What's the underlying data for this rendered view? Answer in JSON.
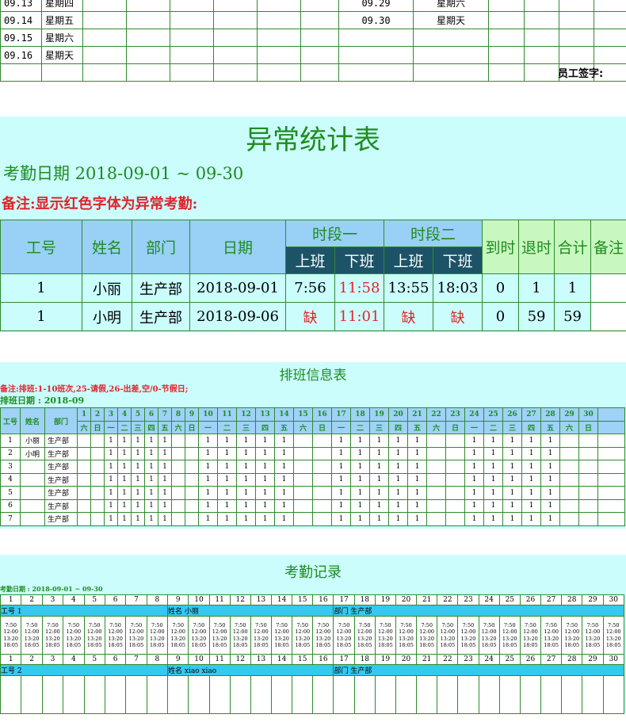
{
  "top_sheet": {
    "left_rows": [
      [
        "09.13",
        "星期四"
      ],
      [
        "09.14",
        "星期五"
      ],
      [
        "09.15",
        "星期六"
      ],
      [
        "09.16",
        "星期天"
      ]
    ],
    "right_rows": [
      [
        "09.29",
        "星期六"
      ],
      [
        "09.30",
        "星期天"
      ]
    ],
    "signature_label": "员工签字:"
  },
  "abnormal": {
    "title": "异常统计表",
    "date_line": "考勤日期 2018-09-01 ~ 09-30",
    "note": "备注:显示红色字体为异常考勤:",
    "headers": {
      "id": "工号",
      "name": "姓名",
      "dept": "部门",
      "date": "日期",
      "seg1": "时段一",
      "seg2": "时段二",
      "on": "上班",
      "off": "下班",
      "late": "到时",
      "early": "退时",
      "total": "合计",
      "remark": "备注"
    },
    "rows": [
      {
        "id": "1",
        "name": "小丽",
        "dept": "生产部",
        "date": "2018-09-01",
        "in1": "7:56",
        "out1": "11:58",
        "in2": "13:55",
        "out2": "18:03",
        "late": "0",
        "early": "1",
        "total": "1",
        "remark": ""
      },
      {
        "id": "1",
        "name": "小明",
        "dept": "生产部",
        "date": "2018-09-06",
        "in1": "缺",
        "out1": "11:01",
        "in2": "缺",
        "out2": "缺",
        "late": "0",
        "early": "59",
        "total": "59",
        "remark": ""
      }
    ]
  },
  "schedule": {
    "title": "排班信息表",
    "note": "备注:排班:1-10班次,25-请假,26-出差,空/0-节假日;",
    "period": "排班日期 : 2018-09",
    "headers": {
      "id": "工号",
      "name": "姓名",
      "dept": "部门"
    },
    "days": [
      "1",
      "2",
      "3",
      "4",
      "5",
      "6",
      "7",
      "8",
      "9",
      "10",
      "11",
      "12",
      "13",
      "14",
      "15",
      "16",
      "17",
      "18",
      "19",
      "20",
      "21",
      "22",
      "23",
      "24",
      "25",
      "26",
      "27",
      "28",
      "29",
      "30"
    ],
    "weekdays": [
      "六",
      "日",
      "一",
      "二",
      "三",
      "四",
      "五",
      "六",
      "日",
      "一",
      "二",
      "三",
      "四",
      "五",
      "六",
      "日",
      "一",
      "二",
      "三",
      "四",
      "五",
      "六",
      "日",
      "一",
      "二",
      "三",
      "四",
      "五",
      "六",
      "日"
    ],
    "rows": [
      {
        "id": "1",
        "name": "小丽",
        "dept": "生产部"
      },
      {
        "id": "2",
        "name": "小明",
        "dept": "生产部"
      },
      {
        "id": "3",
        "name": "",
        "dept": "生产部"
      },
      {
        "id": "4",
        "name": "",
        "dept": "生产部"
      },
      {
        "id": "5",
        "name": "",
        "dept": "生产部"
      },
      {
        "id": "6",
        "name": "",
        "dept": "生产部"
      },
      {
        "id": "7",
        "name": "",
        "dept": "生产部"
      }
    ],
    "shift_value": "1"
  },
  "records": {
    "title": "考勤记录",
    "date_line": "考勤日期 :   2018-09-01 ~ 09-30",
    "days": [
      "1",
      "2",
      "3",
      "4",
      "5",
      "6",
      "7",
      "8",
      "9",
      "10",
      "11",
      "12",
      "13",
      "14",
      "15",
      "16",
      "17",
      "18",
      "19",
      "20",
      "21",
      "22",
      "23",
      "24",
      "25",
      "26",
      "27",
      "28",
      "29",
      "30"
    ],
    "emp1": {
      "id_label": "工号 1",
      "name_label": "姓名 小丽",
      "dept_label": "部门 生产部"
    },
    "emp2": {
      "id_label": "工号 2",
      "name_label": "姓名 xiao xiao",
      "dept_label": "部门 生产部"
    },
    "punch_times": [
      "7:50",
      "12:00",
      "13:20",
      "18:05"
    ]
  }
}
